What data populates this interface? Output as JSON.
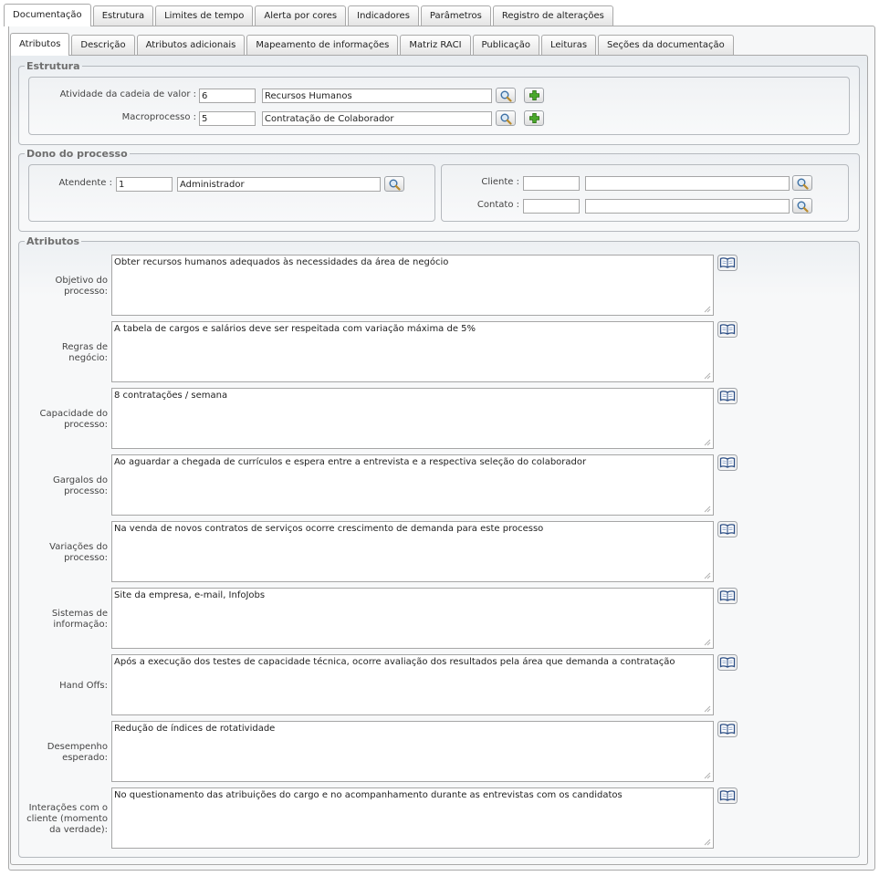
{
  "tabs_outer": [
    "Documentação",
    "Estrutura",
    "Limites de tempo",
    "Alerta por cores",
    "Indicadores",
    "Parâmetros",
    "Registro de alterações"
  ],
  "tabs_inner": [
    "Atributos",
    "Descrição",
    "Atributos adicionais",
    "Mapeamento de informações",
    "Matriz RACI",
    "Publicação",
    "Leituras",
    "Seções da documentação"
  ],
  "estrutura": {
    "legend": "Estrutura",
    "atividade_label": "Atividade da cadeia de valor :",
    "atividade_code": "6",
    "atividade_name": "Recursos Humanos",
    "macro_label": "Macroprocesso :",
    "macro_code": "5",
    "macro_name": "Contratação de Colaborador"
  },
  "dono": {
    "legend": "Dono do processo",
    "atendente_label": "Atendente :",
    "atendente_code": "1",
    "atendente_name": "Administrador",
    "cliente_label": "Cliente :",
    "cliente_code": "",
    "cliente_name": "",
    "contato_label": "Contato :",
    "contato_code": "",
    "contato_name": ""
  },
  "atributos": {
    "legend": "Atributos",
    "items": [
      {
        "label": "Objetivo do processo:",
        "value": "Obter recursos humanos adequados às necessidades da área de negócio"
      },
      {
        "label": "Regras de negócio:",
        "value": "A tabela de cargos e salários deve ser respeitada com variação máxima de 5%"
      },
      {
        "label": "Capacidade do processo:",
        "value": "8 contratações / semana"
      },
      {
        "label": "Gargalos do processo:",
        "value": "Ao aguardar a chegada de currículos e espera entre a entrevista e a respectiva seleção do colaborador"
      },
      {
        "label": "Variações do processo:",
        "value": "Na venda de novos contratos de serviços ocorre crescimento de demanda para este processo"
      },
      {
        "label": "Sistemas de informação:",
        "value": "Site da empresa, e-mail, InfoJobs"
      },
      {
        "label": "Hand Offs:",
        "value": "Após a execução dos testes de capacidade técnica, ocorre avaliação dos resultados pela área que demanda a contratação"
      },
      {
        "label": "Desempenho esperado:",
        "value": "Redução de índices de rotatividade"
      },
      {
        "label": "Interações com o cliente (momento da verdade):",
        "value": "No questionamento das atribuições do cargo e no acompanhamento durante as entrevistas com os candidatos"
      }
    ]
  },
  "colors": {
    "accent_green": "#3a9a1a",
    "border": "#a9a9a9",
    "legend_text": "#6e6e6e"
  }
}
